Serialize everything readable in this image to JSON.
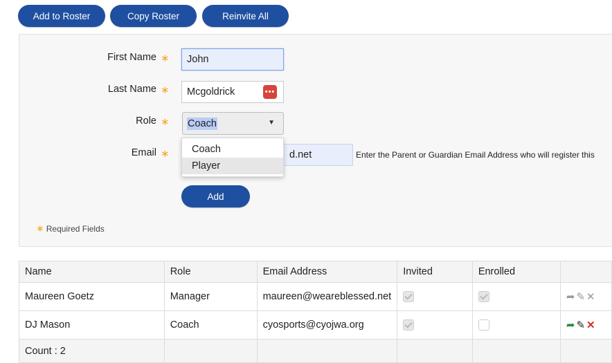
{
  "toolbar": {
    "add_to_roster": "Add to Roster",
    "copy_roster": "Copy Roster",
    "reinvite_all": "Reinvite All"
  },
  "form": {
    "required_marker": "∗",
    "first_name": {
      "label": "First Name",
      "value": "John"
    },
    "last_name": {
      "label": "Last Name",
      "value": "Mcgoldrick"
    },
    "role": {
      "label": "Role",
      "value": "Coach",
      "options": [
        "Coach",
        "Player"
      ]
    },
    "email": {
      "label": "Email",
      "value": "d.net",
      "hint": "Enter the Parent or Guardian Email Address who will register this"
    },
    "add_button": "Add",
    "required_note": "Required Fields"
  },
  "table": {
    "headers": [
      "Name",
      "Role",
      "Email Address",
      "Invited",
      "Enrolled",
      ""
    ],
    "rows": [
      {
        "name": "Maureen Goetz",
        "role": "Manager",
        "email": "maureen@weareblessed.net",
        "invited": true,
        "enrolled": true
      },
      {
        "name": "DJ Mason",
        "role": "Coach",
        "email": "cyosports@cyojwa.org",
        "invited": true,
        "enrolled": false
      }
    ],
    "count": "Count : 2"
  },
  "colors": {
    "primary": "#1f4fa0",
    "required": "#f5a623",
    "delete": "#d62d20",
    "reinvite": "#2a8a3a"
  }
}
